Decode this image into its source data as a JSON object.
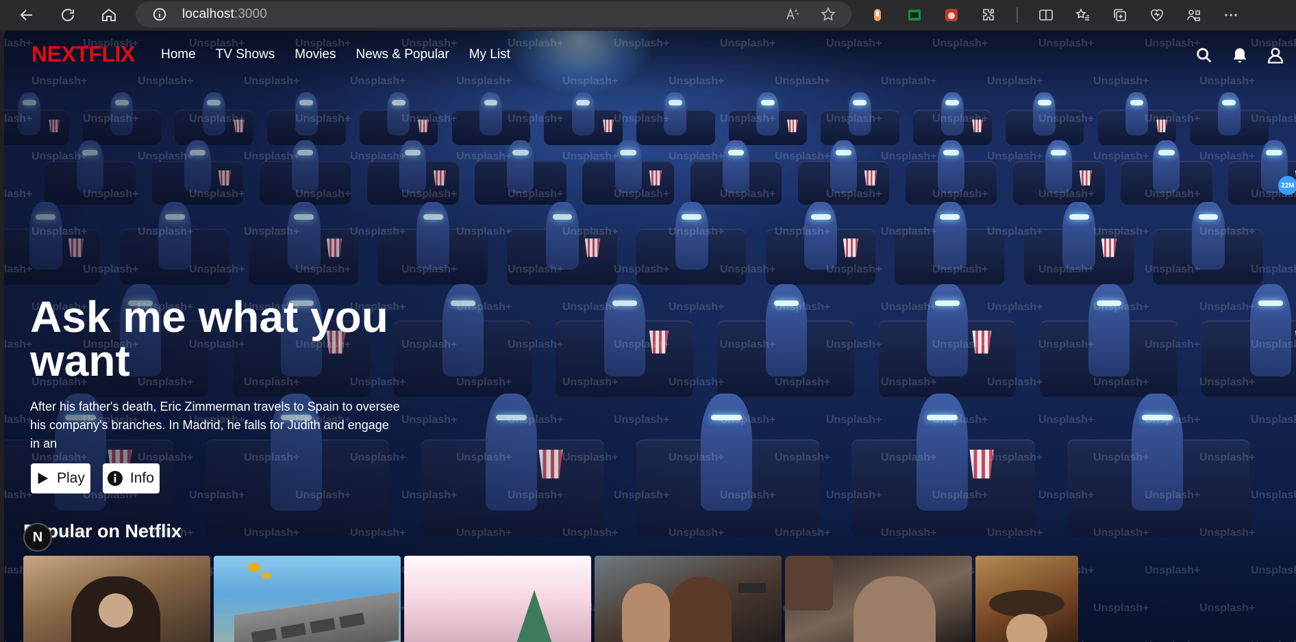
{
  "browser": {
    "url_host": "localhost",
    "url_port": ":3000"
  },
  "app": {
    "logo": "NEXTFLIX",
    "nav": [
      "Home",
      "TV Shows",
      "Movies",
      "News & Popular",
      "My List"
    ]
  },
  "watermark_text": "Unsplash+",
  "side_badge": "22M",
  "hero": {
    "title": "Ask me what you want",
    "description": "After his father's death, Eric Zimmerman travels to Spain to oversee his company's branches. In Madrid, he falls for Judith and engage in an",
    "play_label": "Play",
    "info_label": "Info"
  },
  "row": {
    "title": "Popular on Netflix"
  },
  "dev_badge": "N",
  "colors": {
    "brand": "#e50914",
    "hero_tint": "#1a2d63"
  }
}
